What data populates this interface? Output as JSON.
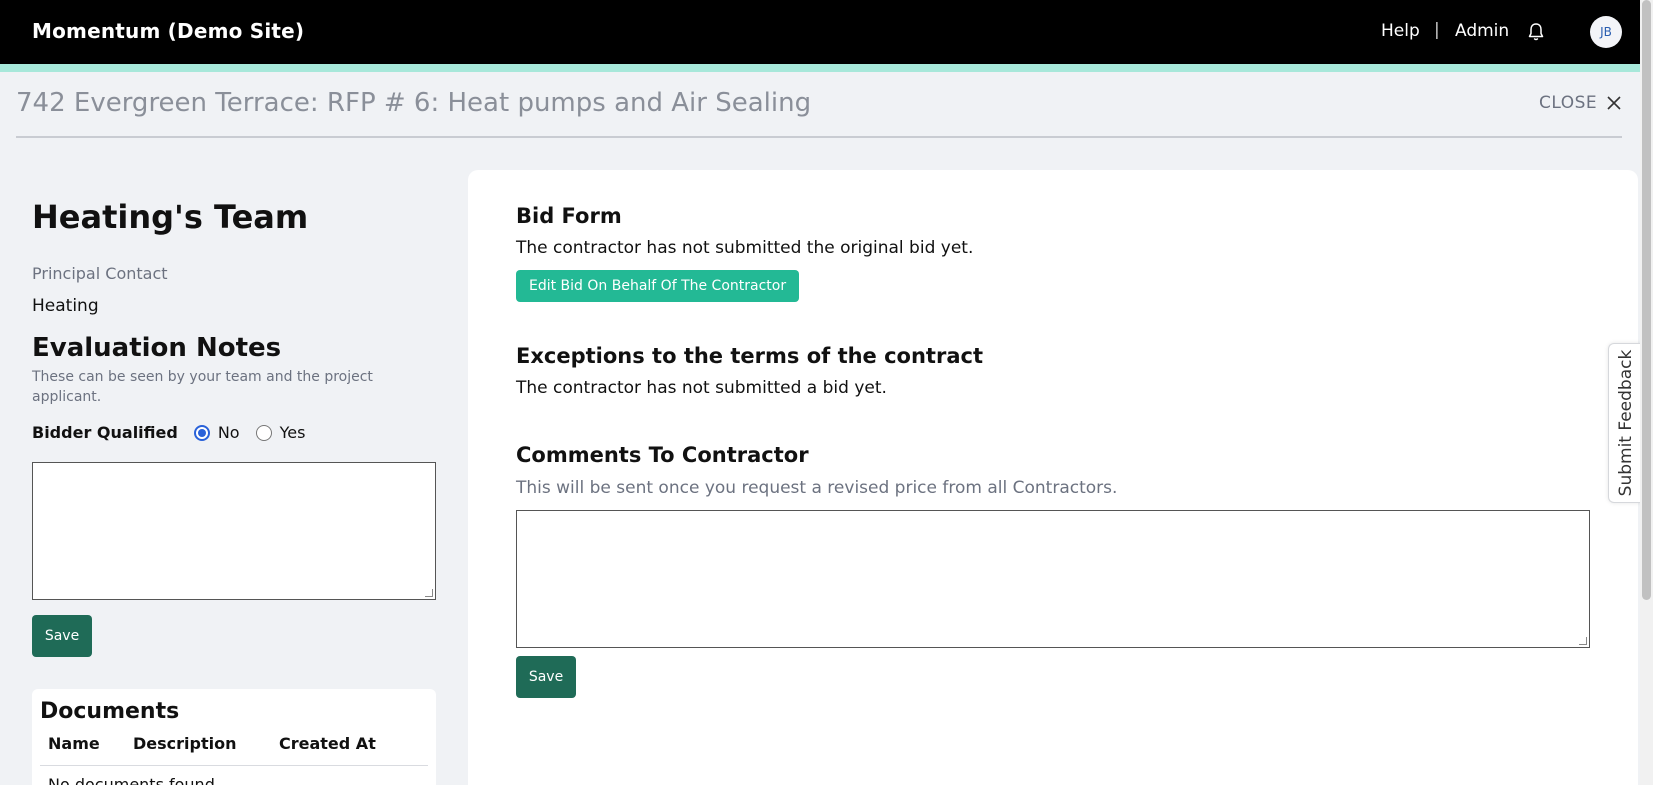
{
  "header": {
    "brand": "Momentum (Demo Site)",
    "help_label": "Help",
    "separator": "|",
    "admin_label": "Admin",
    "avatar_initials": "JB"
  },
  "page": {
    "title": "742 Evergreen Terrace: RFP # 6: Heat pumps and Air Sealing",
    "close_label": "CLOSE"
  },
  "team": {
    "name": "Heating's Team",
    "principal_contact_label": "Principal Contact",
    "principal_contact_value": "Heating"
  },
  "evaluation": {
    "heading": "Evaluation Notes",
    "subtext": "These can be seen by your team and the project applicant.",
    "bidder_qualified_label": "Bidder Qualified",
    "options": [
      "No",
      "Yes"
    ],
    "selected": "No",
    "notes_value": "",
    "save_label": "Save"
  },
  "documents": {
    "heading": "Documents",
    "columns": [
      "Name",
      "Description",
      "Created At"
    ],
    "empty_text": "No documents found"
  },
  "bid_form": {
    "heading": "Bid Form",
    "status": "The contractor has not submitted the original bid yet.",
    "edit_button": "Edit Bid On Behalf Of The Contractor"
  },
  "exceptions": {
    "heading": "Exceptions to the terms of the contract",
    "status": "The contractor has not submitted a bid yet."
  },
  "comments": {
    "heading": "Comments To Contractor",
    "subtext": "This will be sent once you request a revised price from all Contractors.",
    "value": "",
    "save_label": "Save"
  },
  "feedback": {
    "label": "Submit Feedback"
  },
  "colors": {
    "topbar": "#000000",
    "accent_bar": "#a7e8da",
    "save_button": "#1f6b57",
    "edit_button": "#23b995",
    "radio_checked": "#2a62d9"
  }
}
